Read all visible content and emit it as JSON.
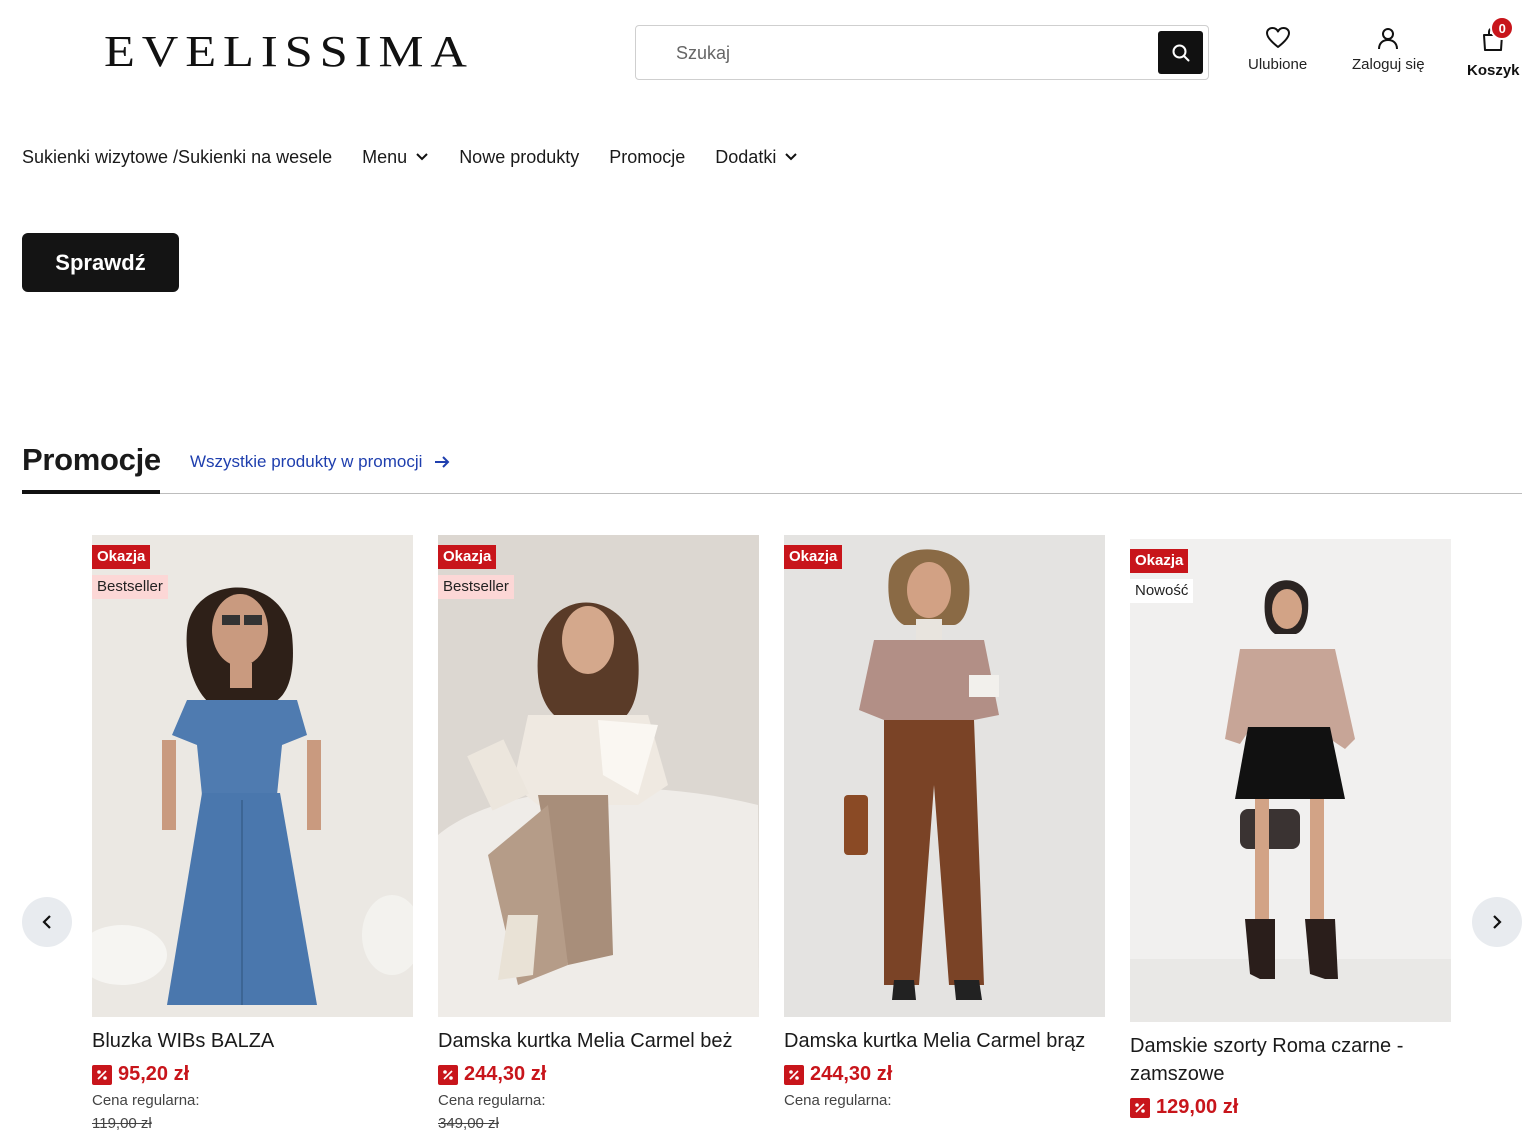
{
  "brand": {
    "logo_text": "EVELISSIMA"
  },
  "search": {
    "placeholder": "Szukaj"
  },
  "header_actions": {
    "favorites_label": "Ulubione",
    "login_label": "Zaloguj się",
    "cart_label": "Koszyk",
    "cart_count": "0"
  },
  "nav": {
    "items": [
      {
        "label": "Sukienki wizytowe /Sukienki na wesele",
        "has_dropdown": false
      },
      {
        "label": "Menu",
        "has_dropdown": true
      },
      {
        "label": "Nowe produkty",
        "has_dropdown": false
      },
      {
        "label": "Promocje",
        "has_dropdown": false
      },
      {
        "label": "Dodatki",
        "has_dropdown": true
      }
    ]
  },
  "hero": {
    "cta_label": "Sprawdź"
  },
  "promo_section": {
    "title": "Promocje",
    "link_label": "Wszystkie produkty w promocji"
  },
  "products": [
    {
      "badges": [
        "Okazja",
        "Bestseller"
      ],
      "name": "Bluzka WIBs BALZA",
      "price": "95,20 zł",
      "regular_label": "Cena regularna:",
      "regular_price": "119,00 zł"
    },
    {
      "badges": [
        "Okazja",
        "Bestseller"
      ],
      "name": "Damska kurtka Melia Carmel beż",
      "price": "244,30 zł",
      "regular_label": "Cena regularna:",
      "regular_price": "349,00 zł"
    },
    {
      "badges": [
        "Okazja"
      ],
      "name": "Damska kurtka Melia Carmel brąz",
      "price": "244,30 zł",
      "regular_label": "Cena regularna:",
      "regular_price": ""
    },
    {
      "badges": [
        "Okazja",
        "Nowość"
      ],
      "name": "Damskie szorty Roma czarne - zamszowe",
      "price": "129,00 zł",
      "regular_label": "",
      "regular_price": ""
    }
  ],
  "colors": {
    "accent_red": "#c8151b",
    "link_blue": "#1f3fae",
    "dark": "#141414"
  }
}
